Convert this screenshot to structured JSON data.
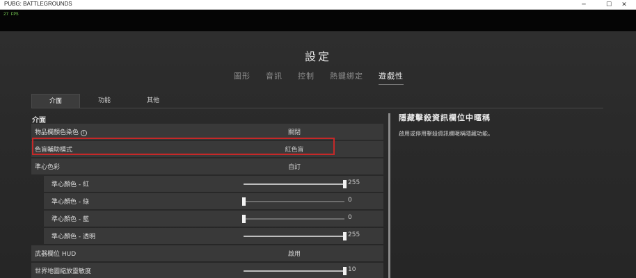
{
  "window": {
    "title": "PUBG: BATTLEGROUNDS",
    "minimize": "─",
    "maximize": "☐",
    "close": "✕"
  },
  "overlay": {
    "fps": "27 FPS"
  },
  "page": {
    "title": "設定"
  },
  "top_tabs": [
    {
      "label": "圖形"
    },
    {
      "label": "音訊"
    },
    {
      "label": "控制"
    },
    {
      "label": "熱鍵綁定"
    },
    {
      "label": "遊戲性",
      "active": true
    }
  ],
  "sub_tabs": [
    {
      "label": "介面",
      "active": true
    },
    {
      "label": "功能"
    },
    {
      "label": "其他"
    }
  ],
  "section": {
    "label": "介面"
  },
  "rows": [
    {
      "label": "物品欄顏色染色",
      "value": "關閉",
      "info": "i"
    },
    {
      "label": "色盲輔助模式",
      "value": "紅色盲"
    },
    {
      "label": "準心色彩",
      "value": "自訂"
    },
    {
      "label": "準心顏色 - 紅",
      "slider": 255,
      "max": 255,
      "value": "255"
    },
    {
      "label": "準心顏色 - 綠",
      "slider": 0,
      "max": 255,
      "value": "0"
    },
    {
      "label": "準心顏色 - 藍",
      "slider": 0,
      "max": 255,
      "value": "0"
    },
    {
      "label": "準心顏色 - 透明",
      "slider": 255,
      "max": 255,
      "value": "255"
    },
    {
      "label": "武器欄位 HUD",
      "value": "啟用"
    },
    {
      "label": "世界地圖縮放靈敏度",
      "slider": 10,
      "max": 10,
      "value": "10"
    }
  ],
  "description": {
    "title": "隱藏擊殺資訊欄位中暱稱",
    "text": "啟用或停用擊殺資訊欄暱稱隱藏功能。"
  },
  "colors": {
    "highlight": "#c62828",
    "fps": "#7ed957"
  }
}
